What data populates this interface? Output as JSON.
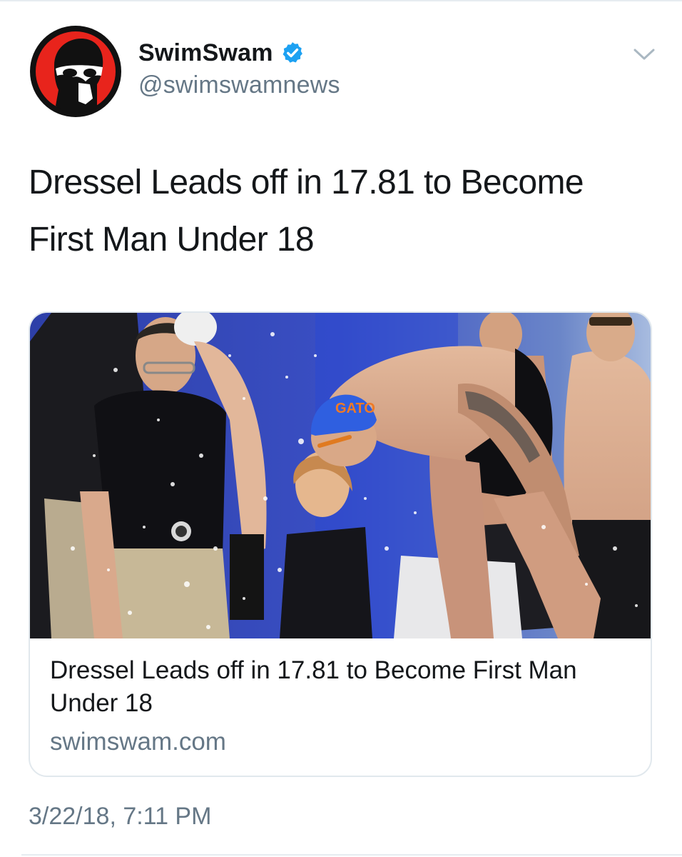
{
  "author": {
    "display_name": "SwimSwam",
    "handle": "@swimswamnews",
    "verified": true,
    "avatar_icon": "swimswam-logo-icon"
  },
  "tweet": {
    "text": "Dressel Leads off in 17.81 to Become First Man Under 18",
    "timestamp": "3/22/18, 7:11 PM"
  },
  "card": {
    "image_icon": "swimmer-start-photo",
    "title": "Dressel Leads off in 17.81 to Become First Man Under 18",
    "domain": "swimswam.com",
    "cap_text": "GATO"
  },
  "colors": {
    "text_primary": "#14171a",
    "text_secondary": "#657786",
    "verified_blue": "#1da1f2",
    "logo_red": "#e8241c",
    "border": "#e1e8ed"
  }
}
